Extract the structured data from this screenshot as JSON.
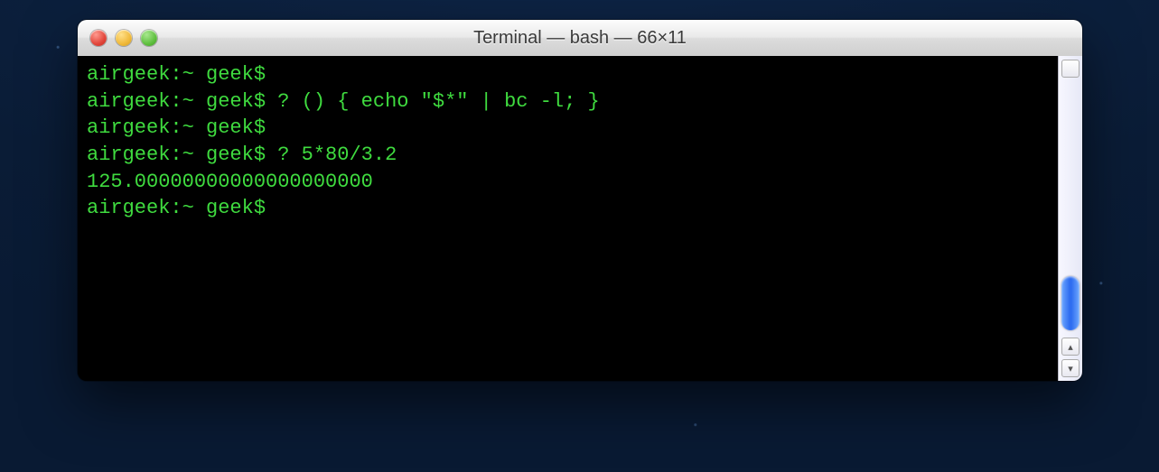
{
  "window": {
    "title": "Terminal — bash — 66×11"
  },
  "terminal": {
    "prompt": "airgeek:~ geek$",
    "lines": [
      {
        "prompt": "airgeek:~ geek$",
        "cmd": ""
      },
      {
        "prompt": "airgeek:~ geek$",
        "cmd": "? () { echo \"$*\" | bc -l; }"
      },
      {
        "prompt": "airgeek:~ geek$",
        "cmd": ""
      },
      {
        "prompt": "airgeek:~ geek$",
        "cmd": "? 5*80/3.2"
      },
      {
        "output": "125.00000000000000000000"
      },
      {
        "prompt": "airgeek:~ geek$",
        "cmd": ""
      }
    ]
  },
  "scrollbar": {
    "up_glyph": "▴",
    "down_glyph": "▾"
  }
}
